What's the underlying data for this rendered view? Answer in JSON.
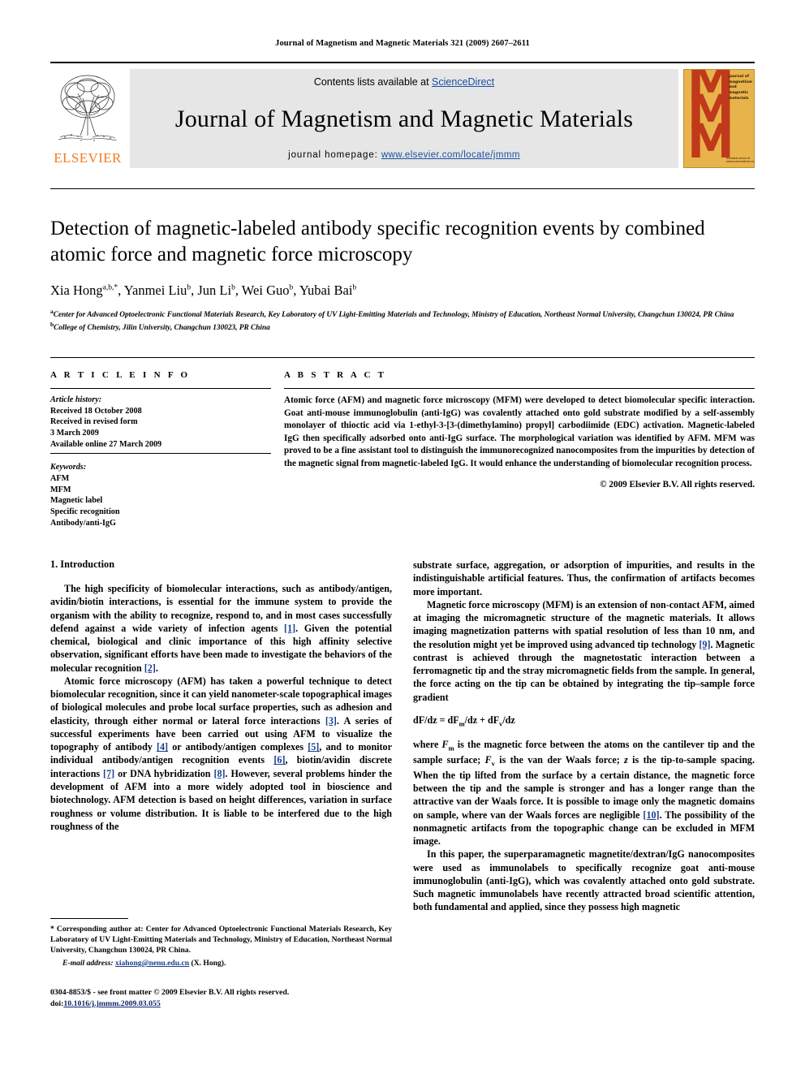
{
  "running_head": "Journal of Magnetism and Magnetic Materials 321 (2009) 2607–2611",
  "masthead": {
    "publisher": "ELSEVIER",
    "contents_prefix": "Contents lists available at ",
    "contents_link": "ScienceDirect",
    "journal_title": "Journal of Magnetism and Magnetic Materials",
    "homepage_prefix": "journal homepage: ",
    "homepage_url": "www.elsevier.com/locate/jmmm",
    "cover": {
      "letters": "MMM",
      "side_text": "journal of magnetism and magnetic materials",
      "foot_text": "Available online at www.sciencedirect.com"
    },
    "colors": {
      "elsevier_orange": "#F47B20",
      "link_blue": "#1a4fa0",
      "cover_bg": "#E8B34B",
      "cover_red": "#C0391B",
      "band_grey": "#e6e6e6"
    }
  },
  "article": {
    "title": "Detection of magnetic-labeled antibody specific recognition events by combined atomic force and magnetic force microscopy",
    "authors": [
      {
        "name": "Xia Hong",
        "sup": "a,b,*"
      },
      {
        "name": "Yanmei Liu",
        "sup": "b"
      },
      {
        "name": "Jun Li",
        "sup": "b"
      },
      {
        "name": "Wei Guo",
        "sup": "b"
      },
      {
        "name": "Yubai Bai",
        "sup": "b"
      }
    ],
    "affiliations": [
      {
        "sup": "a",
        "text": "Center for Advanced Optoelectronic Functional Materials Research, Key Laboratory of UV Light-Emitting Materials and Technology, Ministry of Education, Northeast Normal University, Changchun 130024, PR China"
      },
      {
        "sup": "b",
        "text": "College of Chemistry, Jilin University, Changchun 130023, PR China"
      }
    ]
  },
  "info": {
    "heading": "A R T I C L E    I N F O",
    "history_label": "Article history:",
    "history": [
      "Received 18 October 2008",
      "Received in revised form",
      "3 March 2009",
      "Available online 27 March 2009"
    ],
    "keywords_label": "Keywords:",
    "keywords": [
      "AFM",
      "MFM",
      "Magnetic label",
      "Specific recognition",
      "Antibody/anti-IgG"
    ]
  },
  "abstract": {
    "heading": "A B S T R A C T",
    "text": "Atomic force (AFM) and magnetic force microscopy (MFM) were developed to detect biomolecular specific interaction. Goat anti-mouse immunoglobulin (anti-IgG) was covalently attached onto gold substrate modified by a self-assembly monolayer of thioctic acid via 1-ethyl-3-[3-(dimethylamino) propyl] carbodiimide (EDC) activation. Magnetic-labeled IgG then specifically adsorbed onto anti-IgG surface. The morphological variation was identified by AFM. MFM was proved to be a fine assistant tool to distinguish the immunorecognized nanocomposites from the impurities by detection of the magnetic signal from magnetic-labeled IgG. It would enhance the understanding of biomolecular recognition process.",
    "copyright": "© 2009 Elsevier B.V. All rights reserved."
  },
  "body": {
    "section_number": "1.",
    "section_title": "Introduction",
    "left_paragraphs": [
      {
        "runs": [
          {
            "t": "The high specificity of biomolecular interactions, such as antibody/antigen, avidin/biotin interactions, is essential for the immune system to provide the organism with the ability to recognize, respond to, and in most cases successfully defend against a wide variety of infection agents "
          },
          {
            "t": "[1]",
            "ref": true
          },
          {
            "t": ". Given the potential chemical, biological and clinic importance of this high affinity selective observation, significant efforts have been made to investigate the behaviors of the molecular recognition "
          },
          {
            "t": "[2]",
            "ref": true
          },
          {
            "t": "."
          }
        ]
      },
      {
        "runs": [
          {
            "t": "Atomic force microscopy (AFM) has taken a powerful technique to detect biomolecular recognition, since it can yield nanometer-scale topographical images of biological molecules and probe local surface properties, such as adhesion and elasticity, through either normal or lateral force interactions "
          },
          {
            "t": "[3]",
            "ref": true
          },
          {
            "t": ". A series of successful experiments have been carried out using AFM to visualize the topography of antibody "
          },
          {
            "t": "[4]",
            "ref": true
          },
          {
            "t": " or antibody/antigen complexes "
          },
          {
            "t": "[5]",
            "ref": true
          },
          {
            "t": ", and to monitor individual antibody/antigen recognition events "
          },
          {
            "t": "[6]",
            "ref": true
          },
          {
            "t": ", biotin/avidin discrete interactions "
          },
          {
            "t": "[7]",
            "ref": true
          },
          {
            "t": " or DNA hybridization "
          },
          {
            "t": "[8]",
            "ref": true
          },
          {
            "t": ". However, several problems hinder the development of AFM into a more widely adopted tool in bioscience and biotechnology. AFM detection is based on height differences, variation in surface roughness or volume distribution. It is liable to be interfered due to the high roughness of the"
          }
        ]
      }
    ],
    "right_paragraphs": [
      {
        "no_indent": true,
        "runs": [
          {
            "t": "substrate surface, aggregation, or adsorption of impurities, and results in the indistinguishable artificial features. Thus, the confirmation of artifacts becomes more important."
          }
        ]
      },
      {
        "runs": [
          {
            "t": "Magnetic force microscopy (MFM) is an extension of non-contact AFM, aimed at imaging the micromagnetic structure of the magnetic materials. It allows imaging magnetization patterns with spatial resolution of less than 10 nm, and the resolution might yet be improved using advanced tip technology "
          },
          {
            "t": "[9]",
            "ref": true
          },
          {
            "t": ". Magnetic contrast is achieved through the magnetostatic interaction between a ferromagnetic tip and the stray micromagnetic fields from the sample. In general, the force acting on the tip can be obtained by integrating the tip–sample force gradient"
          }
        ]
      }
    ],
    "equation": "dF/dz = dFm/dz + dFv/dz",
    "right_paragraphs_after_eq": [
      {
        "no_indent": true,
        "runs": [
          {
            "t": "where Fm is the magnetic force between the atoms on the cantilever tip and the sample surface; Fv is the van der Waals force; z is the tip-to-sample spacing. When the tip lifted from the surface by a certain distance, the magnetic force between the tip and the sample is stronger and has a longer range than the attractive van der Waals force. It is possible to image only the magnetic domains on sample, where van der Waals forces are negligible "
          },
          {
            "t": "[10]",
            "ref": true
          },
          {
            "t": ". The possibility of the nonmagnetic artifacts from the topographic change can be excluded in MFM image."
          }
        ]
      },
      {
        "runs": [
          {
            "t": "In this paper, the superparamagnetic magnetite/dextran/IgG nanocomposites were used as immunolabels to specifically recognize goat anti-mouse immunoglobulin (anti-IgG), which was covalently attached onto gold substrate. Such magnetic immunolabels have recently attracted broad scientific attention, both fundamental and applied, since they possess high magnetic"
          }
        ]
      }
    ]
  },
  "footnote": {
    "corresponding": "* Corresponding author at: Center for Advanced Optoelectronic Functional Materials Research, Key Laboratory of UV Light-Emitting Materials and Technology, Ministry of Education, Northeast Normal University, Changchun 130024, PR China.",
    "email_label": "E-mail address:",
    "email": "xiahong@nenu.edu.cn",
    "email_suffix": "(X. Hong)."
  },
  "front_matter": {
    "issn_line": "0304-8853/$ - see front matter © 2009 Elsevier B.V. All rights reserved.",
    "doi_label": "doi:",
    "doi": "10.1016/j.jmmm.2009.03.055"
  }
}
